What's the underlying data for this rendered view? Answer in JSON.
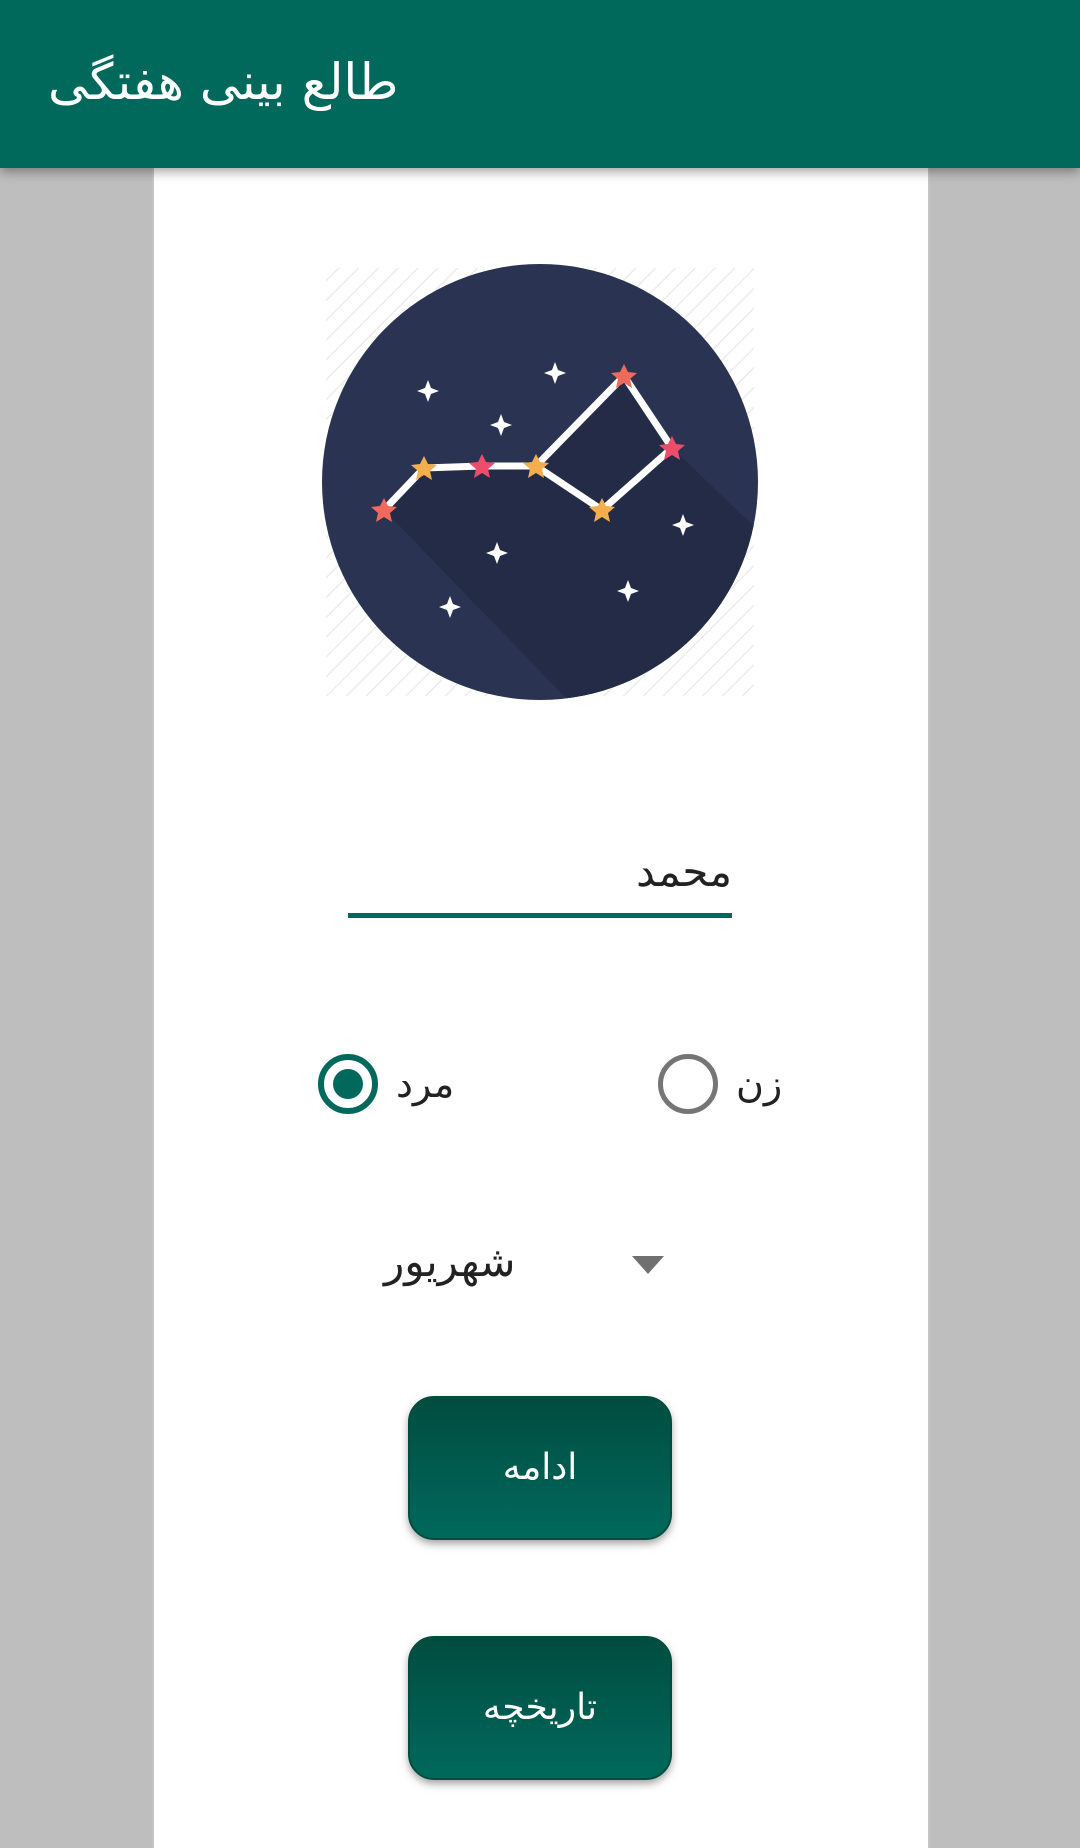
{
  "app_bar": {
    "title": "طالع بینی هفتگی",
    "color": "#00695c"
  },
  "logo": {
    "icon": "constellation-icon"
  },
  "form": {
    "name_value": "محمد",
    "gender": {
      "male_label": "مرد",
      "female_label": "زن",
      "selected": "male"
    },
    "month_selected": "شهریور"
  },
  "buttons": {
    "continue_label": "ادامه",
    "history_label": "تاریخچه"
  }
}
